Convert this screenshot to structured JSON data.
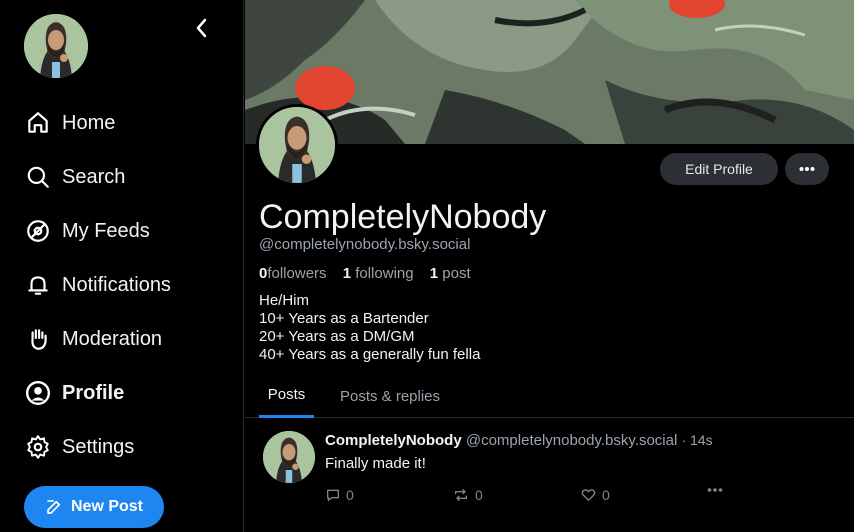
{
  "sidebar": {
    "items": [
      {
        "label": "Home",
        "icon": "home-icon"
      },
      {
        "label": "Search",
        "icon": "search-icon"
      },
      {
        "label": "My Feeds",
        "icon": "feeds-icon"
      },
      {
        "label": "Notifications",
        "icon": "bell-icon"
      },
      {
        "label": "Moderation",
        "icon": "hand-icon"
      },
      {
        "label": "Profile",
        "icon": "user-icon"
      },
      {
        "label": "Settings",
        "icon": "gear-icon"
      }
    ],
    "active": "Profile",
    "new_post_label": "New Post"
  },
  "profile": {
    "display_name": "CompletelyNobody",
    "handle": "@completelynobody.bsky.social",
    "followers_count": "0",
    "followers_label": "followers",
    "following_count": "1",
    "following_label": "following",
    "posts_count": "1",
    "posts_label": "post",
    "bio": [
      "He/Him",
      "10+ Years as a Bartender",
      "20+ Years as a DM/GM",
      "40+ Years as a generally fun fella"
    ],
    "edit_label": "Edit Profile"
  },
  "tabs": [
    {
      "label": "Posts",
      "active": true
    },
    {
      "label": "Posts & replies",
      "active": false
    }
  ],
  "post": {
    "author": "CompletelyNobody",
    "handle": "@completelynobody.bsky.social",
    "time": "· 14s",
    "text": "Finally made it!",
    "reply_count": "0",
    "repost_count": "0",
    "like_count": "0"
  },
  "colors": {
    "accent": "#1d86f0",
    "background": "#000000",
    "muted_text": "#9aa4ae",
    "button_bg": "#2c2f33"
  }
}
